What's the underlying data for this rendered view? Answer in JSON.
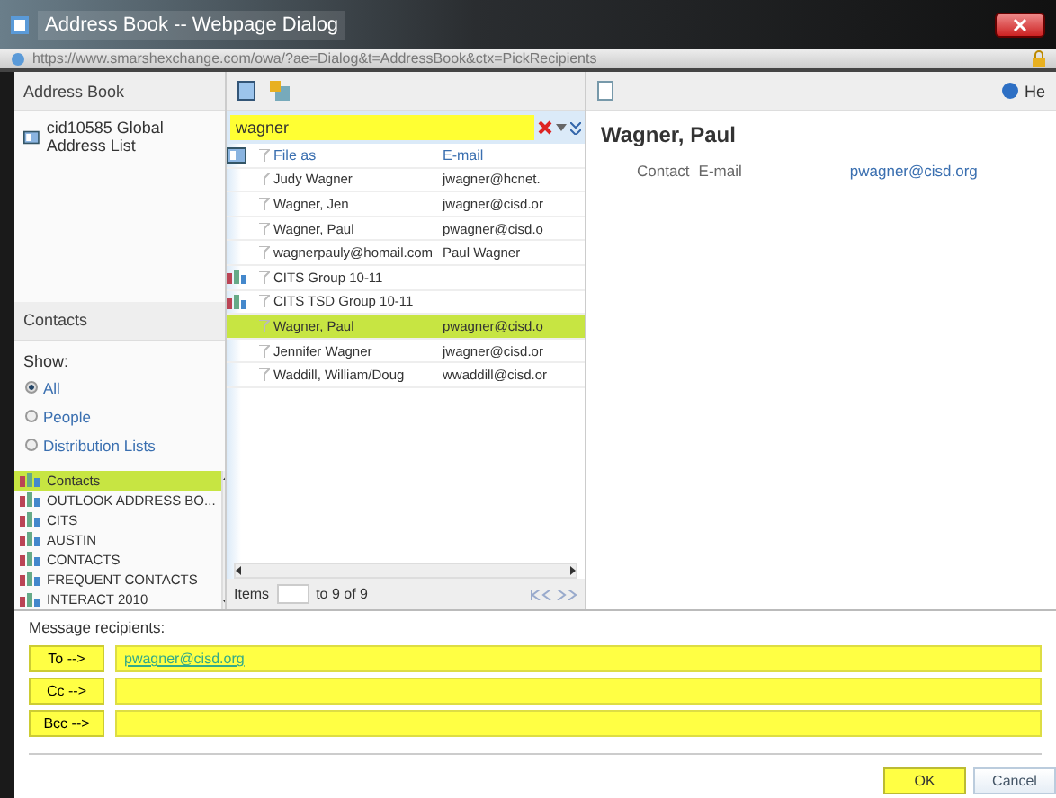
{
  "window": {
    "title": "Address Book -- Webpage Dialog"
  },
  "address_bar": {
    "url": "https://www.smarshexchange.com/owa/?ae=Dialog&t=AddressBook&ctx=PickRecipients"
  },
  "address_book": {
    "header": "Address Book",
    "lists": [
      {
        "label": "cid10585 Global Address List"
      }
    ]
  },
  "contacts": {
    "header": "Contacts",
    "show_label": "Show:",
    "filters": [
      {
        "label": "All",
        "selected": true
      },
      {
        "label": "People",
        "selected": false
      },
      {
        "label": "Distribution Lists",
        "selected": false
      }
    ],
    "folders": [
      {
        "label": "Contacts",
        "selected": true
      },
      {
        "label": "OUTLOOK ADDRESS BO...",
        "selected": false
      },
      {
        "label": "CITS",
        "selected": false
      },
      {
        "label": "AUSTIN",
        "selected": false
      },
      {
        "label": "CONTACTS",
        "selected": false
      },
      {
        "label": "FREQUENT CONTACTS",
        "selected": false
      },
      {
        "label": "INTERACT 2010",
        "selected": false
      }
    ]
  },
  "search": {
    "value": "wagner"
  },
  "results": {
    "columns": [
      "File as",
      "E-mail"
    ],
    "rows": [
      {
        "kind": "contact",
        "file_as": "Judy Wagner",
        "email": "jwagner@hcnet.",
        "selected": false
      },
      {
        "kind": "contact",
        "file_as": "Wagner, Jen",
        "email": "jwagner@cisd.or",
        "selected": false
      },
      {
        "kind": "contact",
        "file_as": "Wagner, Paul",
        "email": "pwagner@cisd.o",
        "selected": false
      },
      {
        "kind": "contact",
        "file_as": "wagnerpauly@homail.com",
        "email": "Paul Wagner",
        "selected": false
      },
      {
        "kind": "group",
        "file_as": "CITS Group 10-11",
        "selected": false
      },
      {
        "kind": "group",
        "file_as": "CITS TSD Group 10-11",
        "selected": false
      },
      {
        "kind": "contact",
        "file_as": "Wagner, Paul",
        "email": "pwagner@cisd.o",
        "selected": true
      },
      {
        "kind": "contact",
        "file_as": "Jennifer Wagner",
        "email": "jwagner@cisd.or",
        "selected": false
      },
      {
        "kind": "contact",
        "file_as": "Waddill, William/Doug",
        "email": "wwaddill@cisd.or",
        "selected": false
      }
    ]
  },
  "pager": {
    "label": "Items",
    "range": "to 9 of 9"
  },
  "details": {
    "help": "He",
    "name": "Wagner, Paul",
    "field_label": "Contact",
    "field_type": "E-mail",
    "email": "pwagner@cisd.org"
  },
  "recipients": {
    "label": "Message recipients:",
    "rows": [
      {
        "button": "To -->",
        "value": "pwagner@cisd.org"
      },
      {
        "button": "Cc -->"
      },
      {
        "button": "Bcc -->"
      }
    ]
  },
  "buttons": [
    {
      "label": "OK",
      "kind": "primary"
    },
    {
      "label": "Cancel",
      "kind": "secondary"
    }
  ]
}
